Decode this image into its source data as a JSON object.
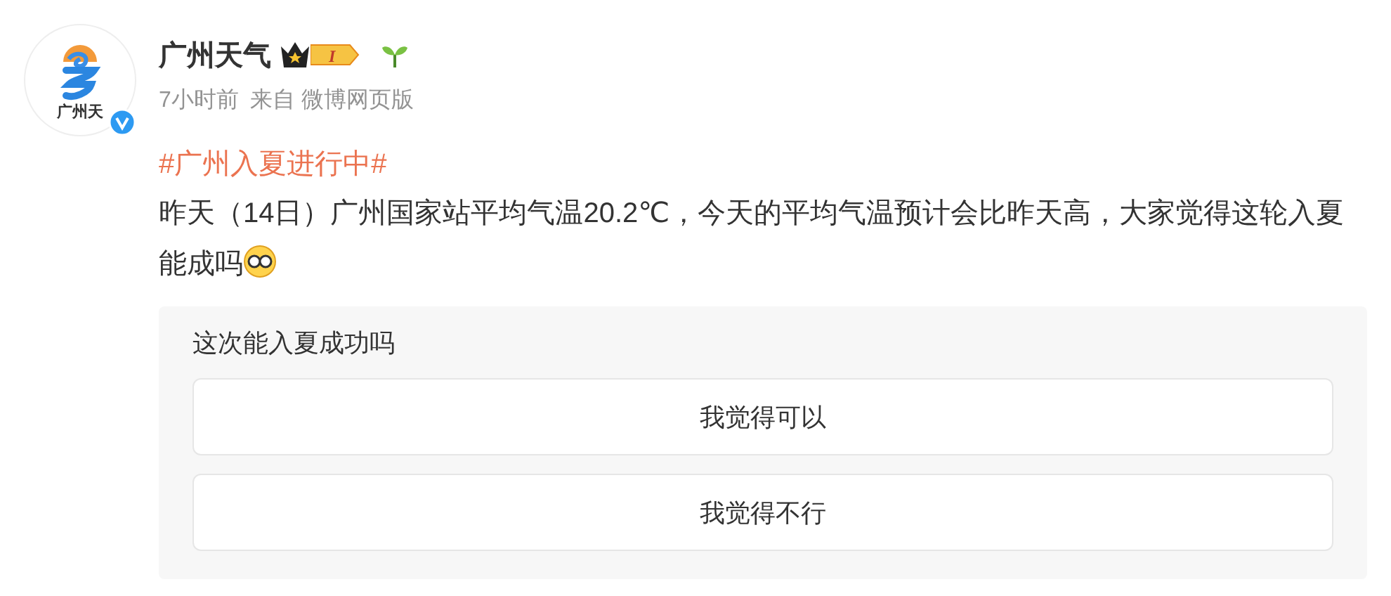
{
  "post": {
    "avatar": {
      "caption": "广州天"
    },
    "verified": true,
    "author": "广州天气",
    "badge": {
      "level": "I"
    },
    "time": "7小时前",
    "source": "来自 微博网页版",
    "hashtag": "#广州入夏进行中#",
    "text": "昨天（14日）广州国家站平均气温20.2℃，今天的平均气温预计会比昨天高，大家觉得这轮入夏能成吗"
  },
  "poll": {
    "title": "这次能入夏成功吗",
    "options": [
      {
        "label": "我觉得可以"
      },
      {
        "label": "我觉得不行"
      }
    ]
  }
}
